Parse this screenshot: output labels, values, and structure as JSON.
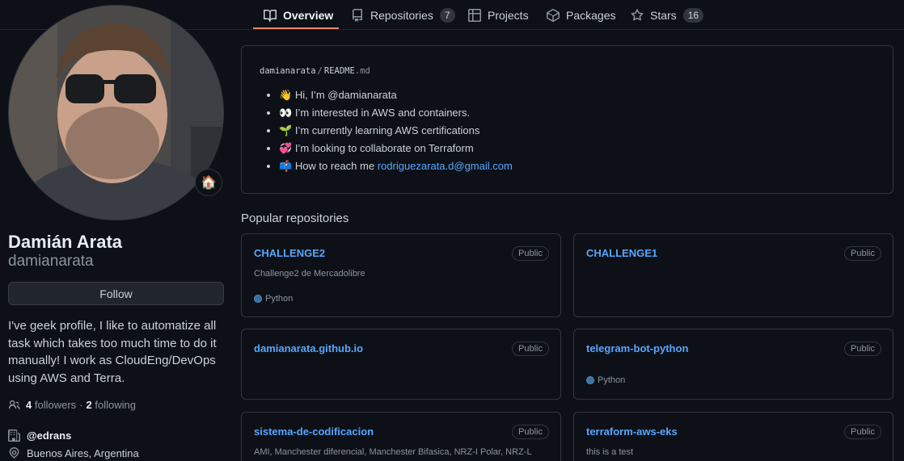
{
  "tabs": [
    {
      "label": "Overview"
    },
    {
      "label": "Repositories",
      "count": "7"
    },
    {
      "label": "Projects"
    },
    {
      "label": "Packages"
    },
    {
      "label": "Stars",
      "count": "16"
    }
  ],
  "profile": {
    "status_emoji": "🏠",
    "fullname": "Damián Arata",
    "username": "damianarata",
    "follow_label": "Follow",
    "bio": "I've geek profile, I like to automatize all task which takes too much time to do it manually! I work as CloudEng/DevOps using AWS and Terra.",
    "followers_count": "4",
    "followers_label": "followers",
    "separator": "·",
    "following_count": "2",
    "following_label": "following",
    "organization": "@edrans",
    "location": "Buenos Aires, Argentina"
  },
  "readme": {
    "owner": "damianarata",
    "sep": "/",
    "file": "README",
    "ext": ".md",
    "items": [
      {
        "emoji": "👋",
        "text": "Hi, I’m @damianarata"
      },
      {
        "emoji": "👀",
        "text": "I’m interested in AWS and containers."
      },
      {
        "emoji": "🌱",
        "text": "I’m currently learning AWS certifications"
      },
      {
        "emoji": "💞️",
        "text": "I’m looking to collaborate on Terraform"
      },
      {
        "emoji": "📫",
        "text": "How to reach me",
        "link": "rodriguezarata.d@gmail.com"
      }
    ]
  },
  "popular": {
    "title": "Popular repositories",
    "repos": [
      {
        "name": "CHALLENGE2",
        "visibility": "Public",
        "description": "Challenge2 de Mercadolibre",
        "language": "Python"
      },
      {
        "name": "CHALLENGE1",
        "visibility": "Public",
        "description": "",
        "language": ""
      },
      {
        "name": "damianarata.github.io",
        "visibility": "Public",
        "description": "",
        "language": ""
      },
      {
        "name": "telegram-bot-python",
        "visibility": "Public",
        "description": "",
        "language": "Python"
      },
      {
        "name": "sistema-de-codificacion",
        "visibility": "Public",
        "description": "AMI, Manchester diferencial, Manchester Bifasica, NRZ-I Polar, NRZ-L",
        "language": ""
      },
      {
        "name": "terraform-aws-eks",
        "visibility": "Public",
        "description": "this is a test",
        "language": ""
      }
    ]
  },
  "colors": {
    "accent": "#f78166",
    "link": "#58a6ff",
    "python": "#3572a5",
    "background": "#0d1117"
  }
}
